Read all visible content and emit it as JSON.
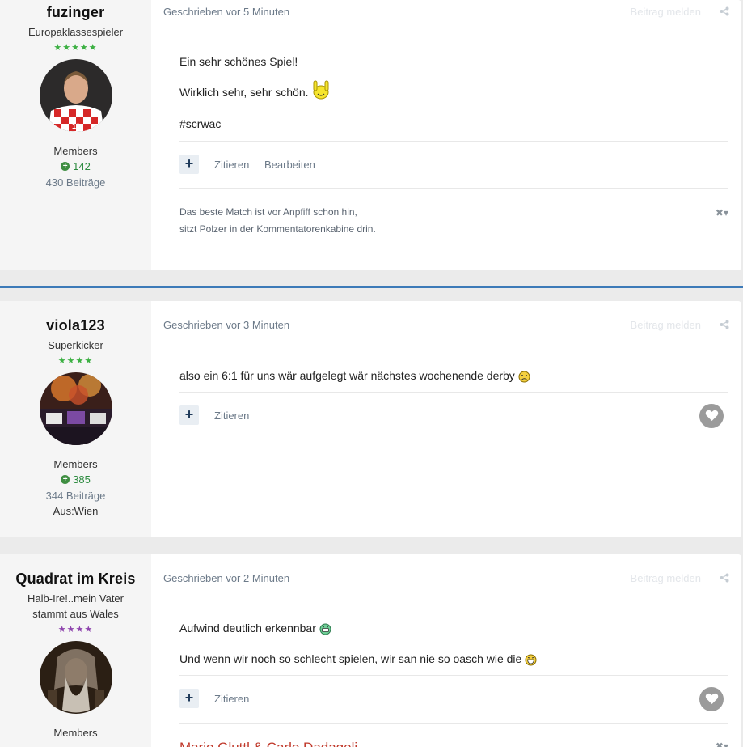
{
  "common": {
    "report_label": "Beitrag melden",
    "quote_label": "Zitieren",
    "edit_label": "Bearbeiten",
    "plus_symbol": "+",
    "group_label": "Members",
    "rep_symbol": "+",
    "sig_ctrl": "✖▾"
  },
  "posts": [
    {
      "author": {
        "name": "fuzinger",
        "title": "Europaklassespieler",
        "stars": "★★★★★",
        "star_color": "#3cb043",
        "reputation": "142",
        "posts_count": "430 Beiträge"
      },
      "time": "Geschrieben vor 5 Minuten",
      "lines": [
        "Ein sehr schönes Spiel!",
        "Wirklich sehr, sehr schön.",
        "#scrwac"
      ],
      "signature": [
        "Das beste Match ist vor Anpfiff schon hin,",
        "sitzt Polzer in der Kommentatorenkabine drin."
      ]
    },
    {
      "author": {
        "name": "viola123",
        "title": "Superkicker",
        "stars": "★★★★",
        "star_color": "#3cb043",
        "reputation": "385",
        "posts_count": "344 Beiträge",
        "location": "Aus:Wien"
      },
      "time": "Geschrieben vor 3 Minuten",
      "lines": [
        "also ein 6:1 für uns wär aufgelegt wär nächstes wochenende derby"
      ]
    },
    {
      "author": {
        "name": "Quadrat im Kreis",
        "title": "Halb-Ire!..mein Vater stammt aus Wales",
        "stars": "★★★★",
        "star_color": "#8e44ad"
      },
      "time": "Geschrieben vor 2 Minuten",
      "lines": [
        "Aufwind deutlich erkennbar",
        "Und wenn wir noch so schlecht spielen, wir san nie so oasch wie die"
      ],
      "signature": [
        "Mario Gluttl & Carlo Dadaqelj"
      ],
      "signature_color": "#c0392b"
    }
  ]
}
